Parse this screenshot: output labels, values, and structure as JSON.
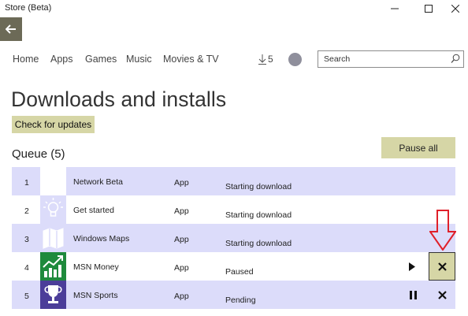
{
  "window": {
    "title": "Store (Beta)"
  },
  "nav": {
    "items": [
      "Home",
      "Apps",
      "Games",
      "Music",
      "Movies & TV"
    ],
    "downloads_count": "5",
    "search_placeholder": "Search"
  },
  "page": {
    "title": "Downloads and installs",
    "check_updates_label": "Check for updates",
    "queue_title": "Queue (5)",
    "pause_all_label": "Pause all"
  },
  "queue": [
    {
      "num": "1",
      "name": "Network Beta",
      "type": "App",
      "status": "Starting download",
      "icon": "blank-icon",
      "icon_color": "#ffffff",
      "controls": []
    },
    {
      "num": "2",
      "name": "Get started",
      "type": "App",
      "status": "Starting download",
      "icon": "lightbulb-icon",
      "icon_color": "#dcdcfa",
      "controls": []
    },
    {
      "num": "3",
      "name": "Windows Maps",
      "type": "App",
      "status": "Starting download",
      "icon": "map-icon",
      "icon_color": "#dcdcfa",
      "controls": []
    },
    {
      "num": "4",
      "name": "MSN Money",
      "type": "App",
      "status": "Paused",
      "icon": "chart-icon",
      "icon_color": "#1e8a3c",
      "controls": [
        "play-icon",
        "cancel-icon"
      ]
    },
    {
      "num": "5",
      "name": "MSN Sports",
      "type": "App",
      "status": "Pending",
      "icon": "trophy-icon",
      "icon_color": "#4b3d99",
      "controls": [
        "pause-icon",
        "cancel-icon"
      ]
    }
  ],
  "colors": {
    "accent": "#d6d6a6",
    "row_alt": "#dcdcfa",
    "back_button": "#6c6a57",
    "annotation_arrow": "#e0202a"
  }
}
